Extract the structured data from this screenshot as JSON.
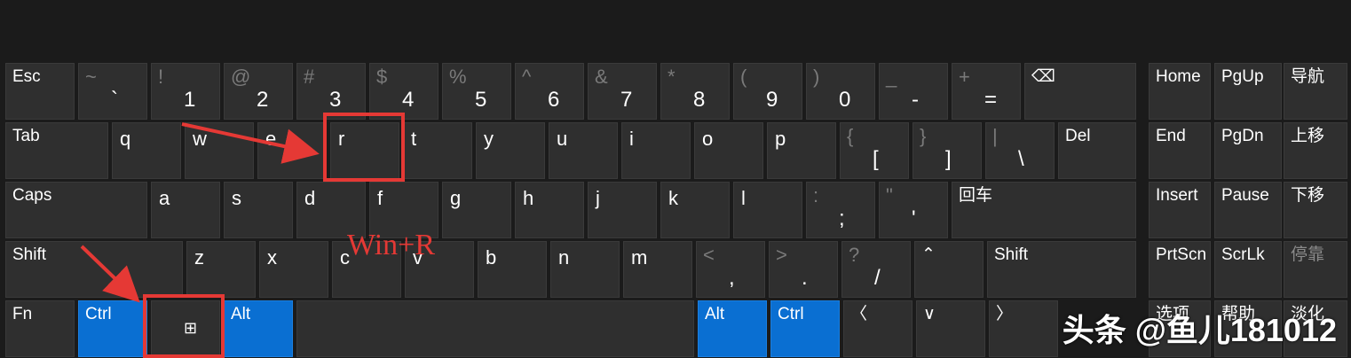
{
  "annotation": "Win+R",
  "watermark": "头条 @鱼儿181012",
  "colors": {
    "key_bg": "#2f2f2f",
    "modifier_bg": "#0a6fd2",
    "highlight": "#e53935"
  },
  "keys": [
    {
      "id": "esc",
      "label": "Esc",
      "type": "tl"
    },
    {
      "id": "tilde",
      "shift": "~",
      "main": "`"
    },
    {
      "id": "1",
      "shift": "!",
      "main": "1"
    },
    {
      "id": "2",
      "shift": "@",
      "main": "2"
    },
    {
      "id": "3",
      "shift": "#",
      "main": "3"
    },
    {
      "id": "4",
      "shift": "$",
      "main": "4"
    },
    {
      "id": "5",
      "shift": "%",
      "main": "5"
    },
    {
      "id": "6",
      "shift": "^",
      "main": "6"
    },
    {
      "id": "7",
      "shift": "&",
      "main": "7"
    },
    {
      "id": "8",
      "shift": "*",
      "main": "8"
    },
    {
      "id": "9",
      "shift": "(",
      "main": "9"
    },
    {
      "id": "0",
      "shift": ")",
      "main": "0"
    },
    {
      "id": "minus",
      "shift": "_",
      "main": "-"
    },
    {
      "id": "equal",
      "shift": "+",
      "main": "="
    },
    {
      "id": "backspace",
      "label": "⌫",
      "type": "tl"
    },
    {
      "id": "home",
      "label": "Home",
      "type": "tl"
    },
    {
      "id": "pgup",
      "label": "PgUp",
      "type": "tl"
    },
    {
      "id": "nav",
      "label": "导航",
      "type": "tl"
    },
    {
      "id": "tab",
      "label": "Tab",
      "type": "tl"
    },
    {
      "id": "q",
      "main": "q"
    },
    {
      "id": "w",
      "main": "w"
    },
    {
      "id": "e",
      "main": "e"
    },
    {
      "id": "r",
      "main": "r"
    },
    {
      "id": "t",
      "main": "t"
    },
    {
      "id": "y",
      "main": "y"
    },
    {
      "id": "u",
      "main": "u"
    },
    {
      "id": "i",
      "main": "i"
    },
    {
      "id": "o",
      "main": "o"
    },
    {
      "id": "p",
      "main": "p"
    },
    {
      "id": "lbracket",
      "shift": "{",
      "main": "["
    },
    {
      "id": "rbracket",
      "shift": "}",
      "main": "]"
    },
    {
      "id": "backslash",
      "shift": "|",
      "main": "\\"
    },
    {
      "id": "del",
      "label": "Del",
      "type": "tl"
    },
    {
      "id": "end",
      "label": "End",
      "type": "tl"
    },
    {
      "id": "pgdn",
      "label": "PgDn",
      "type": "tl"
    },
    {
      "id": "moveup",
      "label": "上移",
      "type": "tl"
    },
    {
      "id": "caps",
      "label": "Caps",
      "type": "tl"
    },
    {
      "id": "a",
      "main": "a"
    },
    {
      "id": "s",
      "main": "s"
    },
    {
      "id": "d",
      "main": "d"
    },
    {
      "id": "f",
      "main": "f"
    },
    {
      "id": "g",
      "main": "g"
    },
    {
      "id": "h",
      "main": "h"
    },
    {
      "id": "j",
      "main": "j"
    },
    {
      "id": "k",
      "main": "k"
    },
    {
      "id": "l",
      "main": "l"
    },
    {
      "id": "semicolon",
      "shift": ":",
      "main": ";"
    },
    {
      "id": "quote",
      "shift": "\"",
      "main": "'"
    },
    {
      "id": "enter",
      "label": "回车",
      "type": "tl"
    },
    {
      "id": "insert",
      "label": "Insert",
      "type": "tl"
    },
    {
      "id": "pause",
      "label": "Pause",
      "type": "tl"
    },
    {
      "id": "movedown",
      "label": "下移",
      "type": "tl"
    },
    {
      "id": "lshift",
      "label": "Shift",
      "type": "tl"
    },
    {
      "id": "z",
      "main": "z"
    },
    {
      "id": "x",
      "main": "x"
    },
    {
      "id": "c",
      "main": "c"
    },
    {
      "id": "v",
      "main": "v"
    },
    {
      "id": "b",
      "main": "b"
    },
    {
      "id": "n",
      "main": "n"
    },
    {
      "id": "m",
      "main": "m"
    },
    {
      "id": "comma",
      "shift": "<",
      "main": ","
    },
    {
      "id": "period",
      "shift": ">",
      "main": "."
    },
    {
      "id": "slash",
      "shift": "?",
      "main": "/"
    },
    {
      "id": "up",
      "label": "⌃",
      "type": "tl"
    },
    {
      "id": "rshift",
      "label": "Shift",
      "type": "tl"
    },
    {
      "id": "prtscn",
      "label": "PrtScn",
      "type": "tl"
    },
    {
      "id": "scrlk",
      "label": "ScrLk",
      "type": "tl"
    },
    {
      "id": "dock",
      "label": "停靠",
      "type": "tl",
      "dim": true
    },
    {
      "id": "fn",
      "label": "Fn",
      "type": "tl"
    },
    {
      "id": "lctrl",
      "label": "Ctrl",
      "type": "tl",
      "blue": true
    },
    {
      "id": "win",
      "label": "⊞",
      "type": "win"
    },
    {
      "id": "lalt",
      "label": "Alt",
      "type": "tl",
      "blue": true
    },
    {
      "id": "space",
      "label": "",
      "type": "tl"
    },
    {
      "id": "ralt",
      "label": "Alt",
      "type": "tl",
      "blue": true
    },
    {
      "id": "rctrl",
      "label": "Ctrl",
      "type": "tl",
      "blue": true
    },
    {
      "id": "left",
      "label": "〈",
      "type": "tl"
    },
    {
      "id": "down",
      "label": "∨",
      "type": "tl"
    },
    {
      "id": "right",
      "label": "〉",
      "type": "tl"
    },
    {
      "id": "options",
      "label": "选项",
      "type": "tl"
    },
    {
      "id": "help",
      "label": "帮助",
      "type": "tl"
    },
    {
      "id": "fade",
      "label": "淡化",
      "type": "tl"
    }
  ]
}
